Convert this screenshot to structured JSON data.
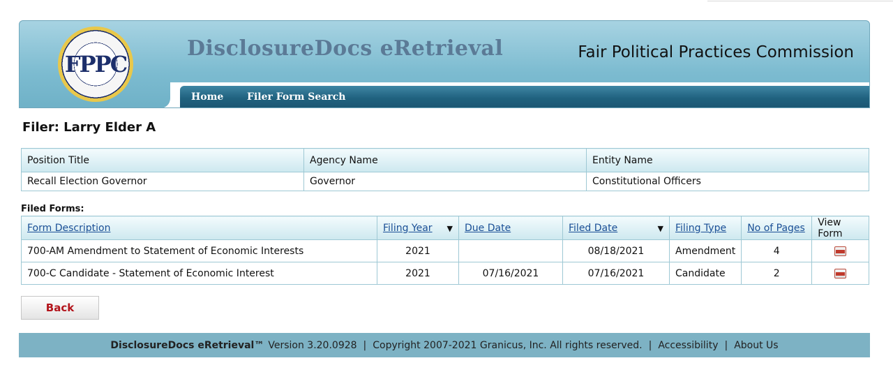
{
  "header": {
    "logo_text": "FPPC",
    "app_title": "DisclosureDocs eRetrieval",
    "org_title": "Fair Political Practices Commission",
    "nav": [
      "Home",
      "Filer Form Search"
    ]
  },
  "filer": {
    "heading": "Filer: Larry Elder A"
  },
  "info_table": {
    "headers": [
      "Position Title",
      "Agency Name",
      "Entity Name"
    ],
    "row": [
      "Recall Election Governor",
      "Governor",
      "Constitutional Officers"
    ]
  },
  "filed_forms": {
    "label": "Filed Forms:",
    "headers": [
      "Form Description",
      "Filing Year",
      "Due Date",
      "Filed Date",
      "Filing Type",
      "No of Pages",
      "View Form"
    ],
    "rows": [
      [
        "700-AM Amendment to Statement of Economic Interests",
        "2021",
        "",
        "08/18/2021",
        "Amendment",
        "4"
      ],
      [
        "700-C Candidate - Statement of Economic Interest",
        "2021",
        "07/16/2021",
        "07/16/2021",
        "Candidate",
        "2"
      ]
    ],
    "view_icon": "pdf-icon"
  },
  "back_label": "Back",
  "footer": {
    "brand": "DisclosureDocs eRetrieval™",
    "version": "Version 3.20.0928",
    "copyright": "Copyright 2007-2021 Granicus, Inc.  All rights reserved.",
    "accessibility": "Accessibility",
    "about": "About Us",
    "separator": "|"
  }
}
